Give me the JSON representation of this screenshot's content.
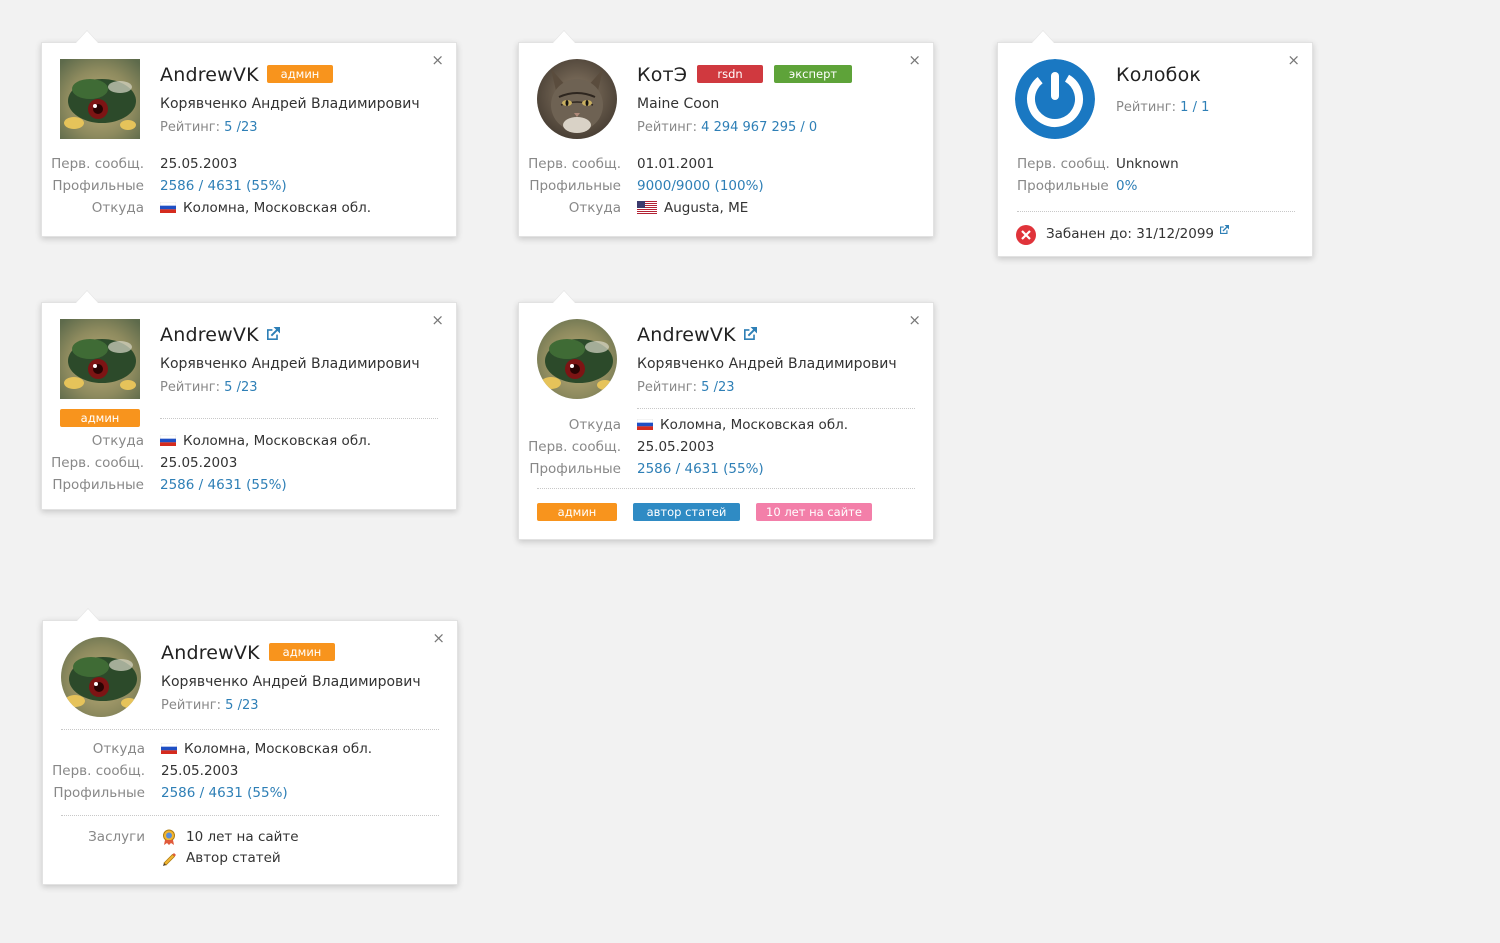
{
  "labels": {
    "first_msg": "Перв. сообщ.",
    "profile": "Профильные",
    "from": "Откуда",
    "rating": "Рейтинг:",
    "merits": "Заслуги",
    "close": "×"
  },
  "user_andrew": {
    "nick": "AndrewVK",
    "full_name": "Корявченко Андрей Владимирович",
    "rating": "5 /23",
    "first_msg": "25.05.2003",
    "profile": "2586 / 4631 (55%)",
    "location": "Коломна, Московская обл."
  },
  "user_kote": {
    "nick": "КотЭ",
    "full_name": "Maine Coon",
    "rating": "4 294 967 295 / 0",
    "first_msg": "01.01.2001",
    "profile": "9000/9000 (100%)",
    "location": "Augusta, ME"
  },
  "user_kolobok": {
    "nick": "Колобок",
    "rating": "1 / 1",
    "first_msg": "Unknown",
    "profile": "0%",
    "ban_text": "Забанен до: 31/12/2099"
  },
  "badges": {
    "admin": "админ",
    "rsdn": "rsdn",
    "expert": "эксперт",
    "author": "автор статей",
    "years": "10 лет на сайте"
  },
  "merits": {
    "years": "10 лет на сайте",
    "author": "Автор статей"
  },
  "colors": {
    "admin": "#f8941d",
    "rsdn": "#d0393f",
    "expert": "#5ea339",
    "author": "#2f8bc4",
    "years": "#f37fa9",
    "link": "#2e7fb6"
  }
}
